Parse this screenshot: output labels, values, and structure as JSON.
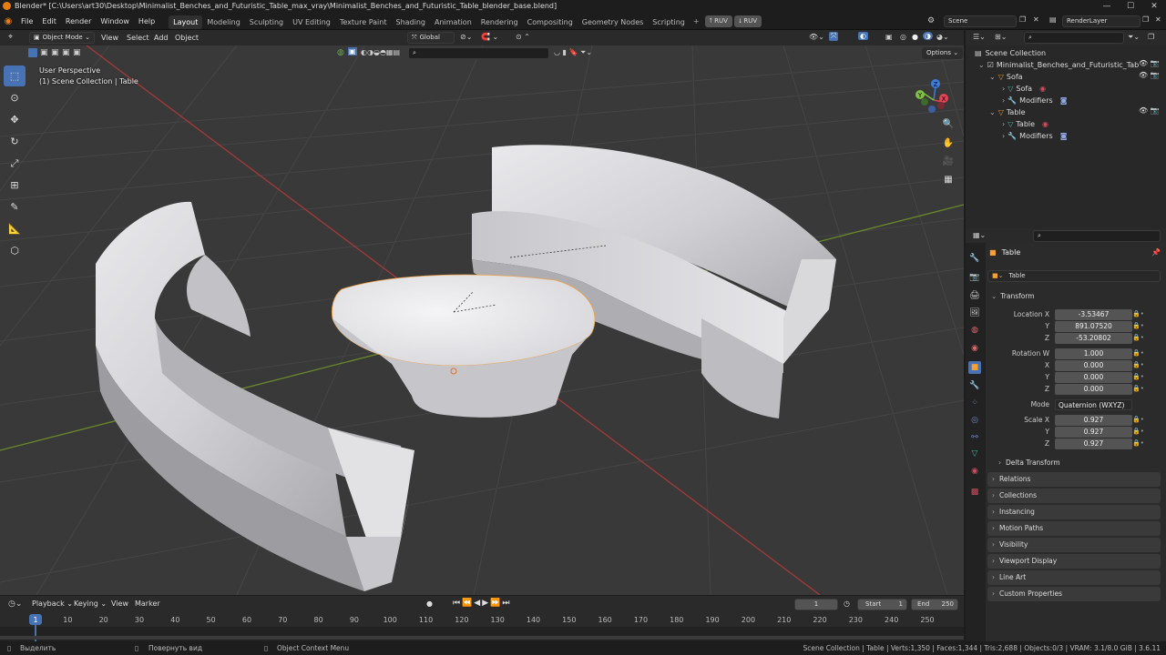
{
  "window": {
    "title": "Blender* [C:\\Users\\art30\\Desktop\\Minimalist_Benches_and_Futuristic_Table_max_vray\\Minimalist_Benches_and_Futuristic_Table_blender_base.blend]"
  },
  "menu": [
    "File",
    "Edit",
    "Render",
    "Window",
    "Help"
  ],
  "workspaces": [
    {
      "label": "Layout",
      "active": true
    },
    {
      "label": "Modeling"
    },
    {
      "label": "Sculpting"
    },
    {
      "label": "UV Editing"
    },
    {
      "label": "Texture Paint"
    },
    {
      "label": "Shading"
    },
    {
      "label": "Animation"
    },
    {
      "label": "Rendering"
    },
    {
      "label": "Compositing"
    },
    {
      "label": "Geometry Nodes"
    },
    {
      "label": "Scripting"
    }
  ],
  "ruv": [
    "RUV",
    "RUV"
  ],
  "scene": {
    "name": "Scene",
    "render_layer": "RenderLayer"
  },
  "viewport_header": {
    "mode": "Object Mode",
    "menus": [
      "View",
      "Select",
      "Add",
      "Object"
    ],
    "orientation": "Global",
    "options": "Options"
  },
  "overlay_text": {
    "perspective": "User Perspective",
    "collection": "(1) Scene Collection | Table"
  },
  "gizmo": {
    "x": "X",
    "y": "Y",
    "z": "Z"
  },
  "outliner": {
    "root": "Scene Collection",
    "items": [
      {
        "label": "Minimalist_Benches_and_Futuristic_Tab",
        "level": 0
      },
      {
        "label": "Sofa",
        "level": 1
      },
      {
        "label": "Sofa",
        "level": 2
      },
      {
        "label": "Modifiers",
        "level": 2
      },
      {
        "label": "Table",
        "level": 1
      },
      {
        "label": "Table",
        "level": 2
      },
      {
        "label": "Modifiers",
        "level": 2
      }
    ]
  },
  "properties": {
    "object_name": "Table",
    "object_name_field": "Table",
    "transform_label": "Transform",
    "location": {
      "label": "Location X",
      "x": "-3.53467",
      "y": "891.07520",
      "z": "-53.20802"
    },
    "rotation": {
      "label": "Rotation W",
      "w": "1.000",
      "x": "0.000",
      "y": "0.000",
      "z": "0.000"
    },
    "mode": {
      "label": "Mode",
      "value": "Quaternion (WXYZ)"
    },
    "scale": {
      "label": "Scale X",
      "x": "0.927",
      "y": "0.927",
      "z": "0.927"
    },
    "axis_labels": {
      "y": "Y",
      "z": "Z",
      "x": "X"
    },
    "delta": "Delta Transform",
    "panels": [
      "Relations",
      "Collections",
      "Instancing",
      "Motion Paths",
      "Visibility",
      "Viewport Display",
      "Line Art",
      "Custom Properties"
    ]
  },
  "timeline": {
    "menus": [
      "Playback",
      "Keying",
      "View",
      "Marker"
    ],
    "current_frame": "1",
    "start_label": "Start",
    "start": "1",
    "end_label": "End",
    "end": "250",
    "ticks": [
      "1",
      "10",
      "20",
      "30",
      "40",
      "50",
      "60",
      "70",
      "80",
      "90",
      "100",
      "110",
      "120",
      "130",
      "140",
      "150",
      "160",
      "170",
      "180",
      "190",
      "200",
      "210",
      "220",
      "230",
      "240",
      "250"
    ]
  },
  "statusbar": {
    "select": "Выделить",
    "rotate": "Повернуть вид",
    "context": "Object Context Menu",
    "stats": "Scene Collection | Table | Verts:1,350 | Faces:1,344 | Tris:2,688 | Objects:0/3 | VRAM: 3.1/8.0 GiB | 3.6.11"
  },
  "colors": {
    "accent": "#4772b3",
    "x_axis": "#a53a3a",
    "y_axis": "#6a8a2a",
    "gizmo_x": "#e04455",
    "gizmo_y": "#80c040",
    "gizmo_z": "#3b7ddd"
  }
}
